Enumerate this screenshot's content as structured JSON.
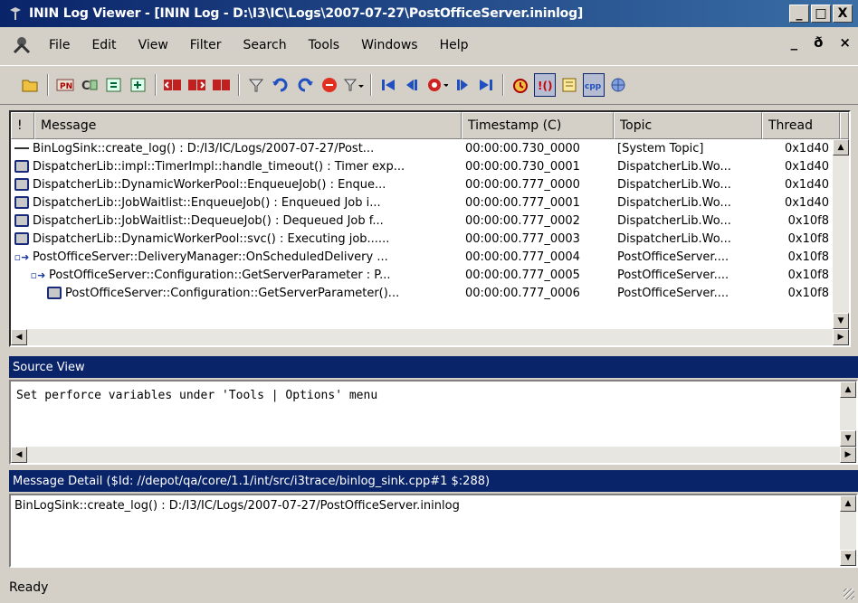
{
  "window": {
    "title": "ININ Log Viewer - [ININ Log - D:\\I3\\IC\\Logs\\2007-07-27\\PostOfficeServer.ininlog]",
    "minimize": "_",
    "restore": "□",
    "close": "X"
  },
  "menu": {
    "items": [
      {
        "label": "File"
      },
      {
        "label": "Edit"
      },
      {
        "label": "View"
      },
      {
        "label": "Filter"
      },
      {
        "label": "Search"
      },
      {
        "label": "Tools"
      },
      {
        "label": "Windows"
      },
      {
        "label": "Help"
      }
    ],
    "mdi_minimize": "_",
    "mdi_restore": "ð",
    "mdi_close": "×"
  },
  "toolbar": {
    "icons": [
      "open-folder-icon",
      "log-icon",
      "process-icon",
      "refresh-icon",
      "refresh-all-icon",
      "bookmark-prev-icon",
      "bookmark-next-icon",
      "bookmark-icon",
      "filter-icon",
      "undo-icon",
      "redo-icon",
      "stop-icon",
      "filter-options-icon",
      "first-icon",
      "prev-icon",
      "record-icon",
      "next-icon",
      "last-icon",
      "trace-icon",
      "count-icon",
      "notes-icon",
      "cpp-icon",
      "globe-icon"
    ]
  },
  "grid": {
    "columns": {
      "flag": "!",
      "message": "Message",
      "timestamp": "Timestamp (C)",
      "topic": "Topic",
      "thread": "Thread"
    },
    "rows": [
      {
        "icon": "dash",
        "message": "BinLogSink::create_log() : D:/I3/IC/Logs/2007-07-27/Post...",
        "timestamp": "00:00:00.730_0000",
        "topic": "[System Topic]",
        "thread": "0x1d40"
      },
      {
        "icon": "box",
        "message": "DispatcherLib::impl::TimerImpl::handle_timeout() : Timer exp...",
        "timestamp": "00:00:00.730_0001",
        "topic": "DispatcherLib.Wo...",
        "thread": "0x1d40"
      },
      {
        "icon": "box",
        "message": "DispatcherLib::DynamicWorkerPool::EnqueueJob() : Enque...",
        "timestamp": "00:00:00.777_0000",
        "topic": "DispatcherLib.Wo...",
        "thread": "0x1d40"
      },
      {
        "icon": "box",
        "message": "DispatcherLib::JobWaitlist::EnqueueJob() : Enqueued Job i...",
        "timestamp": "00:00:00.777_0001",
        "topic": "DispatcherLib.Wo...",
        "thread": "0x1d40"
      },
      {
        "icon": "box",
        "message": "DispatcherLib::JobWaitlist::DequeueJob() : Dequeued Job f...",
        "timestamp": "00:00:00.777_0002",
        "topic": "DispatcherLib.Wo...",
        "thread": "0x10f8"
      },
      {
        "icon": "box",
        "message": "DispatcherLib::DynamicWorkerPool::svc() : Executing job......",
        "timestamp": "00:00:00.777_0003",
        "topic": "DispatcherLib.Wo...",
        "thread": "0x10f8"
      },
      {
        "icon": "arrow",
        "message": "PostOfficeServer::DeliveryManager::OnScheduledDelivery ...",
        "timestamp": "00:00:00.777_0004",
        "topic": "PostOfficeServer....",
        "thread": "0x10f8"
      },
      {
        "icon": "arrow",
        "message": "PostOfficeServer::Configuration::GetServerParameter : P...",
        "timestamp": "00:00:00.777_0005",
        "topic": "PostOfficeServer....",
        "thread": "0x10f8"
      },
      {
        "icon": "box",
        "message": "PostOfficeServer::Configuration::GetServerParameter()...",
        "timestamp": "00:00:00.777_0006",
        "topic": "PostOfficeServer....",
        "thread": "0x10f8"
      }
    ]
  },
  "source_view": {
    "title": "Source View",
    "text": "Set perforce variables under 'Tools | Options' menu"
  },
  "message_detail": {
    "title": "Message Detail ($Id: //depot/qa/core/1.1/int/src/i3trace/binlog_sink.cpp#1 $:288)",
    "text": "BinLogSink::create_log() : D:/I3/IC/Logs/2007-07-27/PostOfficeServer.ininlog"
  },
  "status": {
    "text": "Ready"
  }
}
